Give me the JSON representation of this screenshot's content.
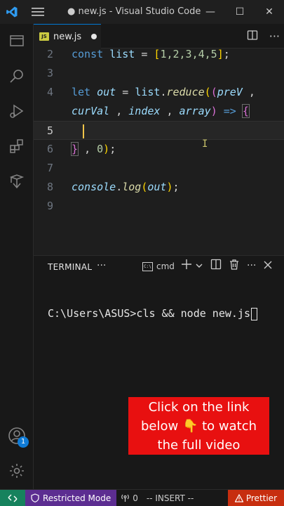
{
  "window": {
    "title": "● new.js - Visual Studio Code",
    "controls": {
      "minimize": "—",
      "maximize": "☐",
      "close": "✕"
    }
  },
  "colors": {
    "accent": "#0078d4",
    "restricted": "#5c2d91",
    "prettier": "#c72e0f",
    "remote": "#16825d",
    "promo": "#e81010"
  },
  "activity_bar": {
    "items": [
      {
        "name": "explorer",
        "icon": "files-icon"
      },
      {
        "name": "search",
        "icon": "search-icon"
      },
      {
        "name": "run-debug",
        "icon": "run-debug-icon"
      },
      {
        "name": "extensions",
        "icon": "extensions-icon"
      },
      {
        "name": "remote",
        "icon": "remote-explorer-icon"
      }
    ],
    "bottom": [
      {
        "name": "accounts",
        "icon": "account-icon",
        "badge": "1"
      },
      {
        "name": "manage",
        "icon": "gear-icon"
      }
    ]
  },
  "tab": {
    "icon_text": "JS",
    "label": "new.js",
    "modified": true
  },
  "editor": {
    "lines": [
      {
        "num": "2"
      },
      {
        "num": "3"
      },
      {
        "num": "4"
      },
      {
        "num": ""
      },
      {
        "num": "5"
      },
      {
        "num": "6"
      },
      {
        "num": "7"
      },
      {
        "num": "8"
      },
      {
        "num": "9"
      }
    ],
    "tokens": {
      "const": "const",
      "list": "list",
      "eq": "=",
      "arr_open": "[",
      "arr_vals": "1,2,3,4,5",
      "arr_close": "]",
      "semi": ";",
      "let": "let",
      "out": "out",
      "dot": ".",
      "reduce": "reduce",
      "paren_open": "(",
      "paren_inner_open": "(",
      "prev": "preV",
      "comma": ",",
      "curval": "curVal",
      "index": "index",
      "array": "array",
      "paren_inner_close": ")",
      "arrow": "=>",
      "brace_open": "{",
      "brace_close": "}",
      "zero": "0",
      "paren_close": ")",
      "console": "console",
      "log": "log",
      "log_open": "(",
      "log_close": ")"
    }
  },
  "panel": {
    "title": "TERMINAL",
    "more": "···",
    "terminal_kind": "cmd",
    "terminal_kind_icon": "C:\\",
    "icons": [
      "add-terminal-icon",
      "chevron-down-icon",
      "split-terminal-icon",
      "trash-icon",
      "more-icon",
      "close-icon"
    ],
    "prompt": "C:\\Users\\ASUS>cls && node new.js"
  },
  "promo": {
    "line1": "Click on the link",
    "line2": "below 👇 to watch",
    "line3": "the full video"
  },
  "status_bar": {
    "restricted": "Restricted Mode",
    "ports": "0",
    "mode": "-- INSERT --",
    "prettier": "Prettier"
  }
}
